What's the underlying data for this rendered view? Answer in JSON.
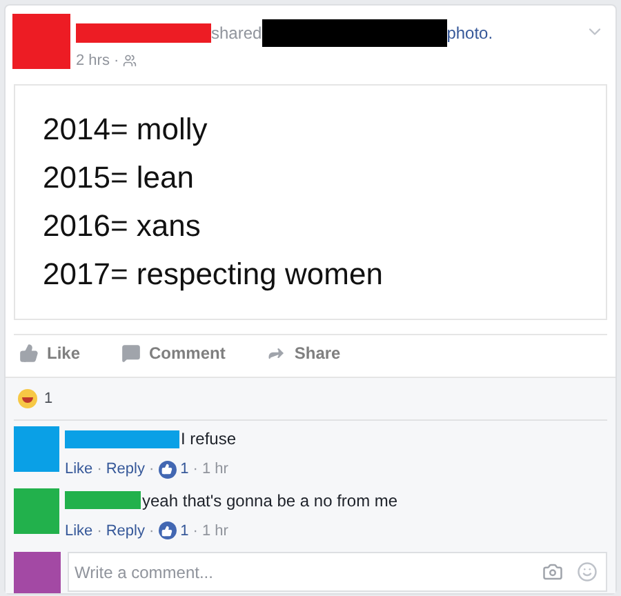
{
  "post": {
    "shared_label": "shared",
    "object_label": "photo.",
    "time": "2 hrs",
    "separator": "·"
  },
  "image_lines": [
    "2014= molly",
    "2015= lean",
    "2016= xans",
    "2017= respecting women"
  ],
  "actions": [
    "Like",
    "Comment",
    "Share"
  ],
  "reactions": {
    "count": "1"
  },
  "comments": [
    {
      "color": "#0aa0e6",
      "text": "I refuse",
      "like": "Like",
      "reply": "Reply",
      "likes": "1",
      "time": "1 hr"
    },
    {
      "color": "#22b14c",
      "text": "yeah that's gonna be a no from me",
      "like": "Like",
      "reply": "Reply",
      "likes": "1",
      "time": "1 hr"
    }
  ],
  "composer": {
    "color": "#a349a4",
    "placeholder": "Write a comment..."
  }
}
